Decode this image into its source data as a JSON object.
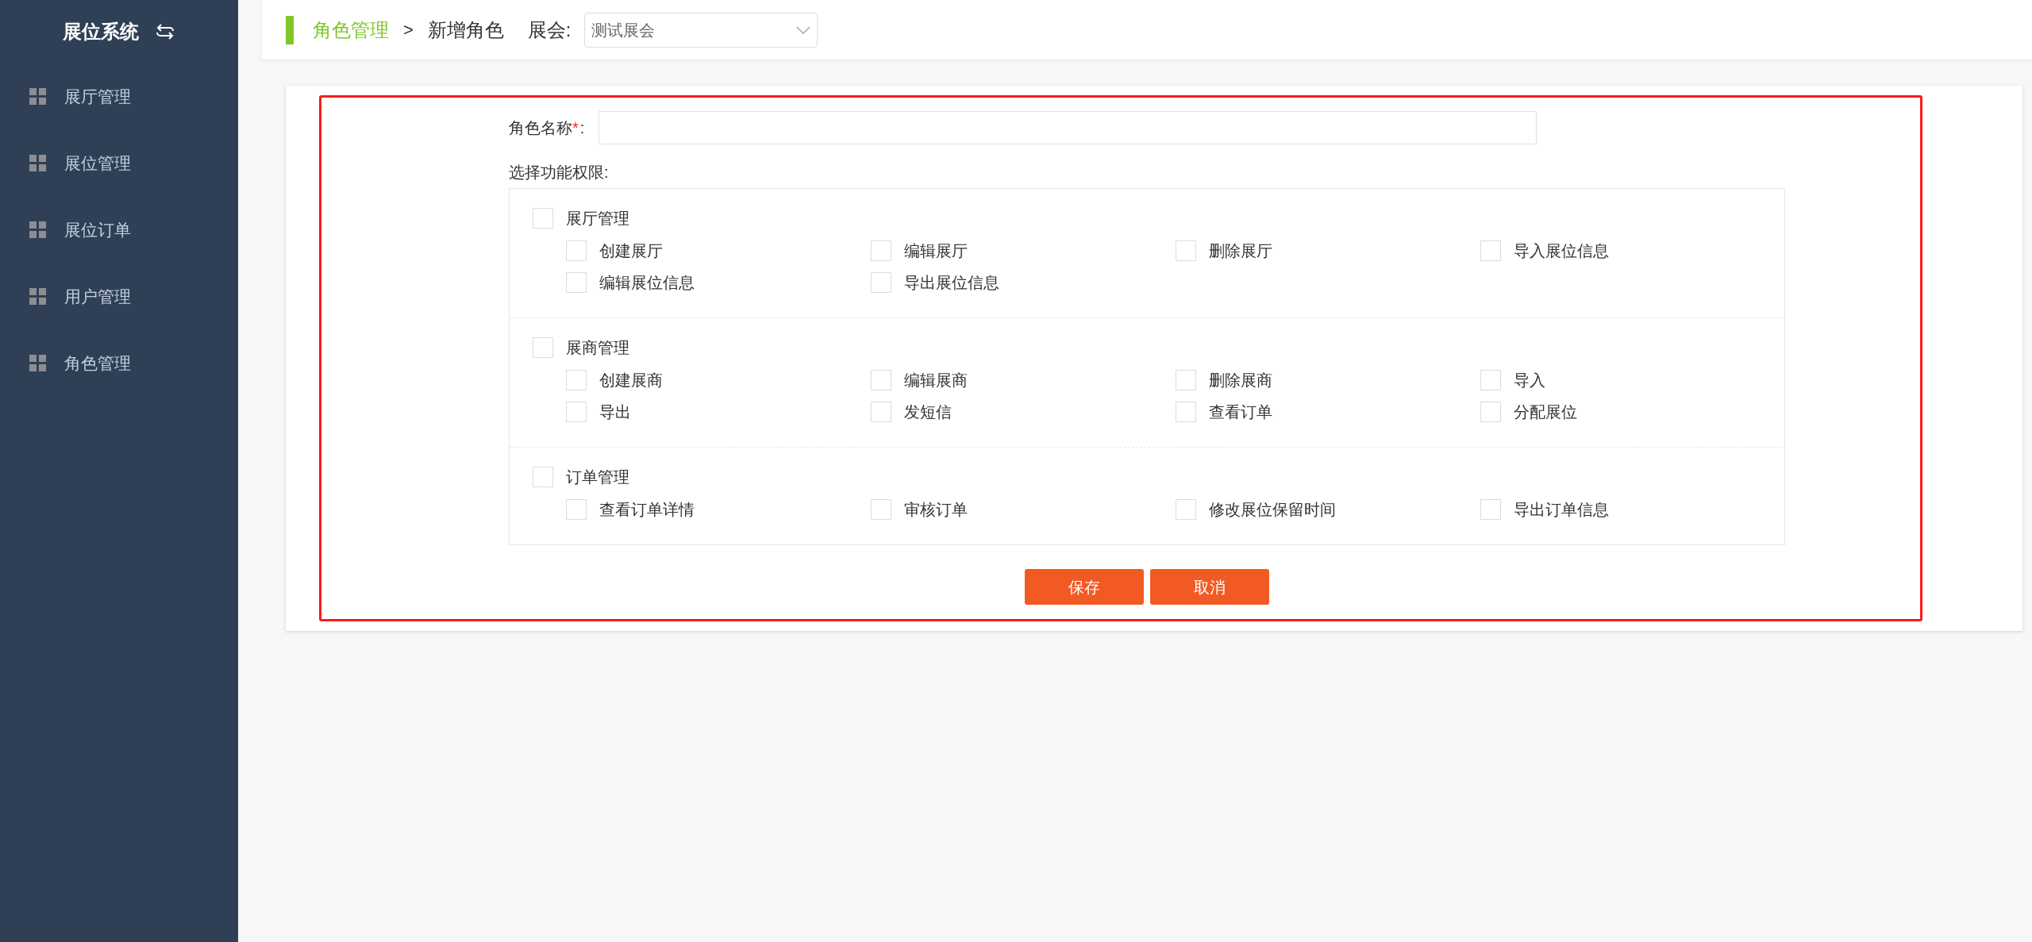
{
  "sidebar": {
    "title": "展位系统",
    "items": [
      {
        "label": "展厅管理",
        "selected": false
      },
      {
        "label": "展位管理",
        "selected": false
      },
      {
        "label": "展位订单",
        "selected": false
      },
      {
        "label": "用户管理",
        "selected": false
      },
      {
        "label": "角色管理",
        "selected": false
      }
    ]
  },
  "breadcrumb": {
    "parent": "角色管理",
    "separator": ">",
    "current": "新增角色"
  },
  "expo_select": {
    "label": "展会:",
    "value": "测试展会"
  },
  "form": {
    "name_label": "角色名称",
    "required_mark": "*",
    "name_colon": ":",
    "permissions_label": "选择功能权限:",
    "groups": [
      {
        "label": "展厅管理",
        "checked": false,
        "children": [
          {
            "label": "创建展厅",
            "checked": false
          },
          {
            "label": "编辑展厅",
            "checked": false
          },
          {
            "label": "删除展厅",
            "checked": false
          },
          {
            "label": "导入展位信息",
            "checked": false
          },
          {
            "label": "编辑展位信息",
            "checked": false
          },
          {
            "label": "导出展位信息",
            "checked": false
          }
        ]
      },
      {
        "label": "展商管理",
        "checked": false,
        "children": [
          {
            "label": "创建展商",
            "checked": false
          },
          {
            "label": "编辑展商",
            "checked": false
          },
          {
            "label": "删除展商",
            "checked": false
          },
          {
            "label": "导入",
            "checked": false
          },
          {
            "label": "导出",
            "checked": false
          },
          {
            "label": "发短信",
            "checked": false
          },
          {
            "label": "查看订单",
            "checked": false
          },
          {
            "label": "分配展位",
            "checked": false
          }
        ]
      },
      {
        "label": "订单管理",
        "checked": false,
        "children": [
          {
            "label": "查看订单详情",
            "checked": false
          },
          {
            "label": "审核订单",
            "checked": false
          },
          {
            "label": "修改展位保留时间",
            "checked": false
          },
          {
            "label": "导出订单信息",
            "checked": false
          }
        ]
      }
    ],
    "buttons": [
      "保存",
      "取消"
    ]
  }
}
